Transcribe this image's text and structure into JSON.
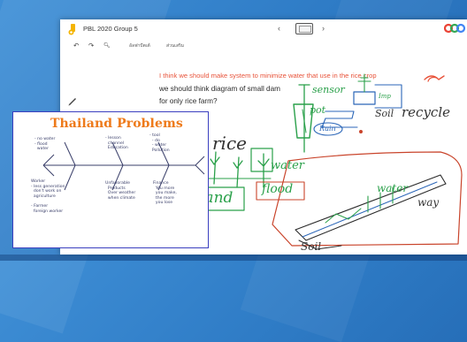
{
  "window": {
    "doc_title": "PBL 2020 Group 5",
    "nav_prev": "‹",
    "nav_next": "›"
  },
  "toolbar": {
    "undo": "↶",
    "redo": "↷",
    "zoom": "🔍︎",
    "menu_items": [
      "อัลฟาบีตเต้",
      "ส่วนเสริม"
    ]
  },
  "canvas": {
    "typed_question": "I think we should make system to minimize water that use in the rice crop",
    "typed_answer_line1": "we should think diagram of small dam",
    "typed_answer_line2": "for only rice farm?",
    "handwriting": {
      "sensor": "sensor",
      "pot": "pot",
      "mbp": "Imp",
      "soil_top": "Soil",
      "recycle": "recycle",
      "rain": "Rain",
      "rice": "rice",
      "water_mid": "water",
      "land": "land",
      "flood": "flood",
      "water_right": "water",
      "way": "way",
      "soil_bottom": "Soil"
    }
  },
  "fishbone": {
    "title": "Thailand Problems",
    "top_notes": [
      "- no water\n- flood\n  water",
      "- lesson\n  channel\n  Education",
      "- tool\n  - do\n  - water\n  Pollution"
    ],
    "bottom_notes": [
      "Worker\n- less generation\n  don't work on\n  agriculture\n\n- Farmer\n  foreign worker",
      "Unfavorable\n  Products\n  Over weather\n  when climate",
      "Finance\n  You more\n  you make,\n  the more\n  you lose"
    ]
  },
  "colors": {
    "accent_text": "#e8533a",
    "ink_green": "#2aa04a",
    "ink_red": "#c9442b",
    "ink_blue": "#2b66b8",
    "fish_title": "#ee7a1a",
    "overlay_border": "#3b3fbf"
  }
}
